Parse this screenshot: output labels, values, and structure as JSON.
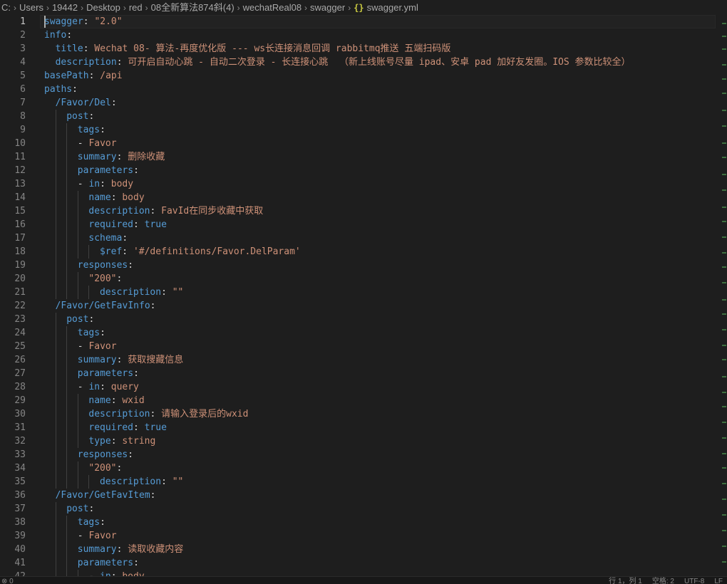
{
  "breadcrumb": {
    "items": [
      "C:",
      "Users",
      "19442",
      "Desktop",
      "red",
      "08全新算法874斜(4)",
      "wechatReal08",
      "swagger"
    ],
    "file_icon": "{}",
    "file_name": "swagger.yml",
    "file_icon_color": "#cbcb41"
  },
  "editor": {
    "cursor_line": 1,
    "lines": [
      [
        {
          "t": "swagger",
          "c": "k"
        },
        {
          "t": ": ",
          "c": "p"
        },
        {
          "t": "\"2.0\"",
          "c": "s"
        }
      ],
      [
        {
          "t": "info",
          "c": "k"
        },
        {
          "t": ":",
          "c": "p"
        }
      ],
      [
        {
          "t": "title",
          "c": "k"
        },
        {
          "t": ": ",
          "c": "p"
        },
        {
          "t": "Wechat 08- 算法-再度优化版 --- ws长连接消息回调 rabbitmq推送 五端扫码版",
          "c": "s"
        }
      ],
      [
        {
          "t": "description",
          "c": "k"
        },
        {
          "t": ": ",
          "c": "p"
        },
        {
          "t": "可开启自动心跳 - 自动二次登录 - 长连接心跳  （新上线账号尽量 ipad、安卓 pad 加好友发圈。IOS 参数比较全）",
          "c": "s"
        }
      ],
      [
        {
          "t": "basePath",
          "c": "k"
        },
        {
          "t": ": ",
          "c": "p"
        },
        {
          "t": "/api",
          "c": "s"
        }
      ],
      [
        {
          "t": "paths",
          "c": "k"
        },
        {
          "t": ":",
          "c": "p"
        }
      ],
      [
        {
          "t": "/Favor/Del",
          "c": "k"
        },
        {
          "t": ":",
          "c": "p"
        }
      ],
      [
        {
          "t": "post",
          "c": "k"
        },
        {
          "t": ":",
          "c": "p"
        }
      ],
      [
        {
          "t": "tags",
          "c": "k"
        },
        {
          "t": ":",
          "c": "p"
        }
      ],
      [
        {
          "t": "- ",
          "c": "p"
        },
        {
          "t": "Favor",
          "c": "s"
        }
      ],
      [
        {
          "t": "summary",
          "c": "k"
        },
        {
          "t": ": ",
          "c": "p"
        },
        {
          "t": "删除收藏",
          "c": "s"
        }
      ],
      [
        {
          "t": "parameters",
          "c": "k"
        },
        {
          "t": ":",
          "c": "p"
        }
      ],
      [
        {
          "t": "- ",
          "c": "p"
        },
        {
          "t": "in",
          "c": "k"
        },
        {
          "t": ": ",
          "c": "p"
        },
        {
          "t": "body",
          "c": "s"
        }
      ],
      [
        {
          "t": "name",
          "c": "k"
        },
        {
          "t": ": ",
          "c": "p"
        },
        {
          "t": "body",
          "c": "s"
        }
      ],
      [
        {
          "t": "description",
          "c": "k"
        },
        {
          "t": ": ",
          "c": "p"
        },
        {
          "t": "FavId在同步收藏中获取",
          "c": "s"
        }
      ],
      [
        {
          "t": "required",
          "c": "k"
        },
        {
          "t": ": ",
          "c": "p"
        },
        {
          "t": "true",
          "c": "b"
        }
      ],
      [
        {
          "t": "schema",
          "c": "k"
        },
        {
          "t": ":",
          "c": "p"
        }
      ],
      [
        {
          "t": "$ref",
          "c": "k"
        },
        {
          "t": ": ",
          "c": "p"
        },
        {
          "t": "'#/definitions/Favor.DelParam'",
          "c": "s"
        }
      ],
      [
        {
          "t": "responses",
          "c": "k"
        },
        {
          "t": ":",
          "c": "p"
        }
      ],
      [
        {
          "t": "\"200\"",
          "c": "s"
        },
        {
          "t": ":",
          "c": "p"
        }
      ],
      [
        {
          "t": "description",
          "c": "k"
        },
        {
          "t": ": ",
          "c": "p"
        },
        {
          "t": "\"\"",
          "c": "s"
        }
      ],
      [
        {
          "t": "/Favor/GetFavInfo",
          "c": "k"
        },
        {
          "t": ":",
          "c": "p"
        }
      ],
      [
        {
          "t": "post",
          "c": "k"
        },
        {
          "t": ":",
          "c": "p"
        }
      ],
      [
        {
          "t": "tags",
          "c": "k"
        },
        {
          "t": ":",
          "c": "p"
        }
      ],
      [
        {
          "t": "- ",
          "c": "p"
        },
        {
          "t": "Favor",
          "c": "s"
        }
      ],
      [
        {
          "t": "summary",
          "c": "k"
        },
        {
          "t": ": ",
          "c": "p"
        },
        {
          "t": "获取搜藏信息",
          "c": "s"
        }
      ],
      [
        {
          "t": "parameters",
          "c": "k"
        },
        {
          "t": ":",
          "c": "p"
        }
      ],
      [
        {
          "t": "- ",
          "c": "p"
        },
        {
          "t": "in",
          "c": "k"
        },
        {
          "t": ": ",
          "c": "p"
        },
        {
          "t": "query",
          "c": "s"
        }
      ],
      [
        {
          "t": "name",
          "c": "k"
        },
        {
          "t": ": ",
          "c": "p"
        },
        {
          "t": "wxid",
          "c": "s"
        }
      ],
      [
        {
          "t": "description",
          "c": "k"
        },
        {
          "t": ": ",
          "c": "p"
        },
        {
          "t": "请输入登录后的wxid",
          "c": "s"
        }
      ],
      [
        {
          "t": "required",
          "c": "k"
        },
        {
          "t": ": ",
          "c": "p"
        },
        {
          "t": "true",
          "c": "b"
        }
      ],
      [
        {
          "t": "type",
          "c": "k"
        },
        {
          "t": ": ",
          "c": "p"
        },
        {
          "t": "string",
          "c": "s"
        }
      ],
      [
        {
          "t": "responses",
          "c": "k"
        },
        {
          "t": ":",
          "c": "p"
        }
      ],
      [
        {
          "t": "\"200\"",
          "c": "s"
        },
        {
          "t": ":",
          "c": "p"
        }
      ],
      [
        {
          "t": "description",
          "c": "k"
        },
        {
          "t": ": ",
          "c": "p"
        },
        {
          "t": "\"\"",
          "c": "s"
        }
      ],
      [
        {
          "t": "/Favor/GetFavItem",
          "c": "k"
        },
        {
          "t": ":",
          "c": "p"
        }
      ],
      [
        {
          "t": "post",
          "c": "k"
        },
        {
          "t": ":",
          "c": "p"
        }
      ],
      [
        {
          "t": "tags",
          "c": "k"
        },
        {
          "t": ":",
          "c": "p"
        }
      ],
      [
        {
          "t": "- ",
          "c": "p"
        },
        {
          "t": "Favor",
          "c": "s"
        }
      ],
      [
        {
          "t": "summary",
          "c": "k"
        },
        {
          "t": ": ",
          "c": "p"
        },
        {
          "t": "读取收藏内容",
          "c": "s"
        }
      ],
      [
        {
          "t": "parameters",
          "c": "k"
        },
        {
          "t": ":",
          "c": "p"
        }
      ],
      [
        {
          "t": "- ",
          "c": "p"
        },
        {
          "t": "in",
          "c": "k"
        },
        {
          "t": ": ",
          "c": "p"
        },
        {
          "t": "body",
          "c": "s"
        }
      ]
    ]
  },
  "colors": {
    "background": "#1e1e1e",
    "key": "#569cd6",
    "string": "#ce9178",
    "boolean": "#569cd6",
    "line_number": "#858585",
    "punctuation": "#d4d4d4"
  },
  "statusbar": {
    "left_text": "⊗ 0",
    "right_items": [
      "行 1，列 1",
      "空格: 2",
      "UTF-8",
      "LF"
    ]
  }
}
